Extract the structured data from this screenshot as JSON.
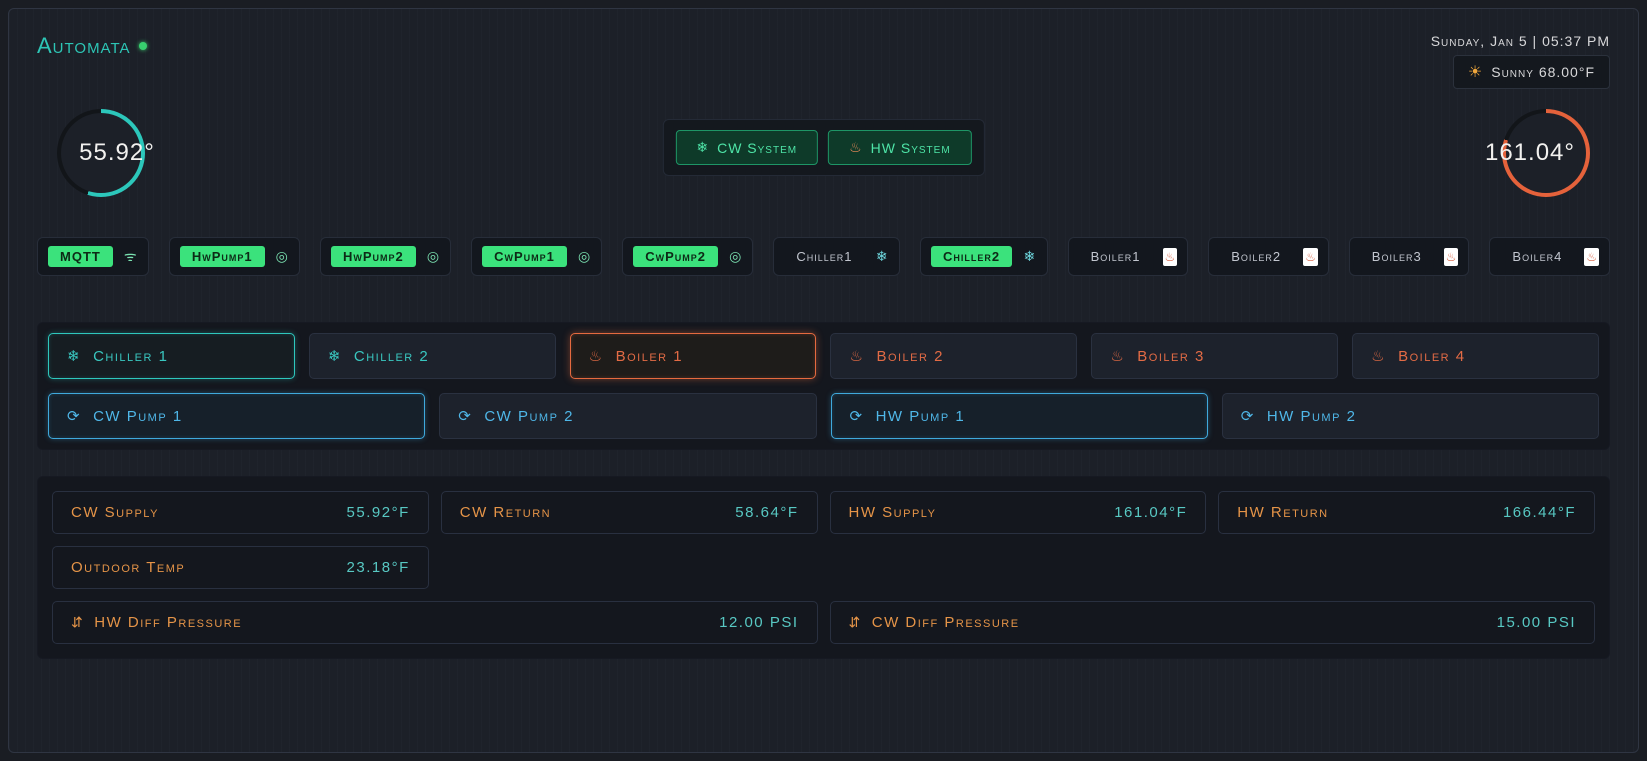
{
  "header": {
    "brand": "Automata",
    "datetime": "Sunday, Jan 5  |  05:37 PM",
    "weather_label": "Sunny 68.00°F"
  },
  "gauges": {
    "cw_value": "55.92°",
    "hw_value": "161.04°"
  },
  "system_toggle": {
    "cw_label": "CW System",
    "hw_label": "HW System"
  },
  "status_badges": [
    {
      "id": "mqtt",
      "label": "MQTT",
      "on": true,
      "icon": "wifi"
    },
    {
      "id": "hwpump1",
      "label": "HwPump1",
      "on": true,
      "icon": "pump"
    },
    {
      "id": "hwpump2",
      "label": "HwPump2",
      "on": true,
      "icon": "pump"
    },
    {
      "id": "cwpump1",
      "label": "CwPump1",
      "on": true,
      "icon": "pump"
    },
    {
      "id": "cwpump2",
      "label": "CwPump2",
      "on": true,
      "icon": "pump"
    },
    {
      "id": "chiller1",
      "label": "Chiller1",
      "on": false,
      "icon": "snow"
    },
    {
      "id": "chiller2",
      "label": "Chiller2",
      "on": true,
      "icon": "snow"
    },
    {
      "id": "boiler1",
      "label": "Boiler1",
      "on": false,
      "icon": "fire"
    },
    {
      "id": "boiler2",
      "label": "Boiler2",
      "on": false,
      "icon": "fire"
    },
    {
      "id": "boiler3",
      "label": "Boiler3",
      "on": false,
      "icon": "fire"
    },
    {
      "id": "boiler4",
      "label": "Boiler4",
      "on": false,
      "icon": "fire"
    }
  ],
  "equipment_tiles": {
    "row1": [
      {
        "id": "chiller1",
        "label": "Chiller 1",
        "kind": "chiller",
        "active": true
      },
      {
        "id": "chiller2",
        "label": "Chiller 2",
        "kind": "chiller",
        "active": false
      },
      {
        "id": "boiler1",
        "label": "Boiler 1",
        "kind": "boiler",
        "active": true
      },
      {
        "id": "boiler2",
        "label": "Boiler 2",
        "kind": "boiler",
        "active": false
      },
      {
        "id": "boiler3",
        "label": "Boiler 3",
        "kind": "boiler",
        "active": false
      },
      {
        "id": "boiler4",
        "label": "Boiler 4",
        "kind": "boiler",
        "active": false
      }
    ],
    "row2": [
      {
        "id": "cwpump1",
        "label": "CW Pump 1",
        "kind": "pump",
        "active": true
      },
      {
        "id": "cwpump2",
        "label": "CW Pump 2",
        "kind": "pump",
        "active": false
      },
      {
        "id": "hwpump1",
        "label": "HW Pump 1",
        "kind": "pump",
        "active": true
      },
      {
        "id": "hwpump2",
        "label": "HW Pump 2",
        "kind": "pump",
        "active": false
      }
    ]
  },
  "readings": {
    "cw_supply": {
      "label": "CW Supply",
      "value": "55.92°F"
    },
    "cw_return": {
      "label": "CW Return",
      "value": "58.64°F"
    },
    "hw_supply": {
      "label": "HW Supply",
      "value": "161.04°F"
    },
    "hw_return": {
      "label": "HW Return",
      "value": "166.44°F"
    },
    "outdoor": {
      "label": "Outdoor Temp",
      "value": "23.18°F"
    },
    "hw_diff_press": {
      "label": "HW Diff Pressure",
      "value": "12.00 PSI"
    },
    "cw_diff_press": {
      "label": "CW Diff Pressure",
      "value": "15.00 PSI"
    }
  }
}
